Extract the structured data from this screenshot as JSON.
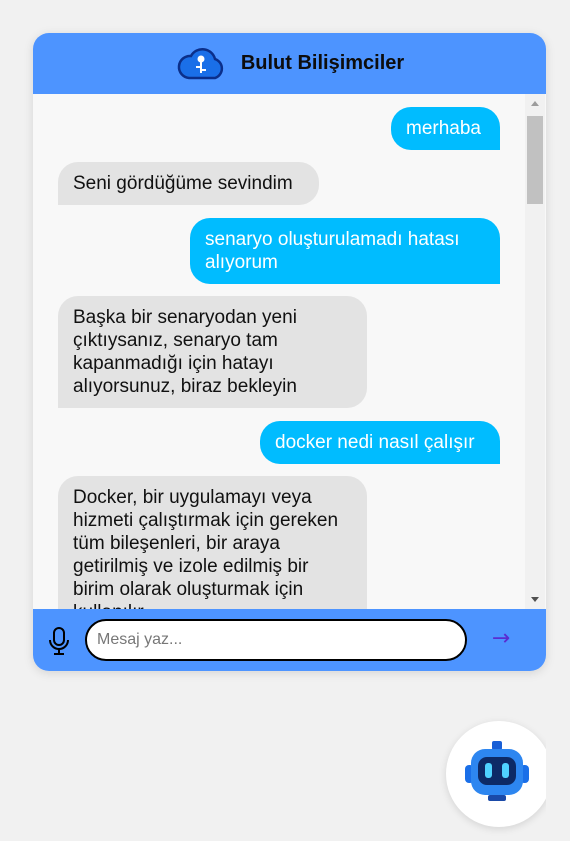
{
  "header": {
    "title": "Bulut Bilişimciler",
    "logo_icon": "cloud-logo-icon"
  },
  "messages": [
    {
      "sender": "user",
      "text": "merhaba"
    },
    {
      "sender": "bot",
      "text": "Seni gördüğüme sevindim"
    },
    {
      "sender": "user",
      "text": "senaryo oluşturulamadı hatası alıyorum"
    },
    {
      "sender": "bot",
      "text": "Başka bir senaryodan yeni çıktıysanız, senaryo tam kapanmadığı için hatayı alıyorsunuz, biraz bekleyin"
    },
    {
      "sender": "user",
      "text": "docker nedi nasıl çalışır"
    },
    {
      "sender": "bot",
      "text": "Docker, bir uygulamayı veya hizmeti çalıştırmak için gereken tüm bileşenleri, bir araya getirilmiş ve izole edilmiş bir birim olarak oluşturmak için kullanılır."
    }
  ],
  "input": {
    "placeholder": "Mesaj yaz...",
    "value": ""
  },
  "send": {
    "label": "→"
  },
  "colors": {
    "header_bg": "#4d94ff",
    "user_bubble": "#00bcff",
    "bot_bubble": "#e3e3e3",
    "send_arrow": "#5a2cd1"
  },
  "icons": {
    "mic": "microphone-icon",
    "launcher": "robot-icon"
  }
}
